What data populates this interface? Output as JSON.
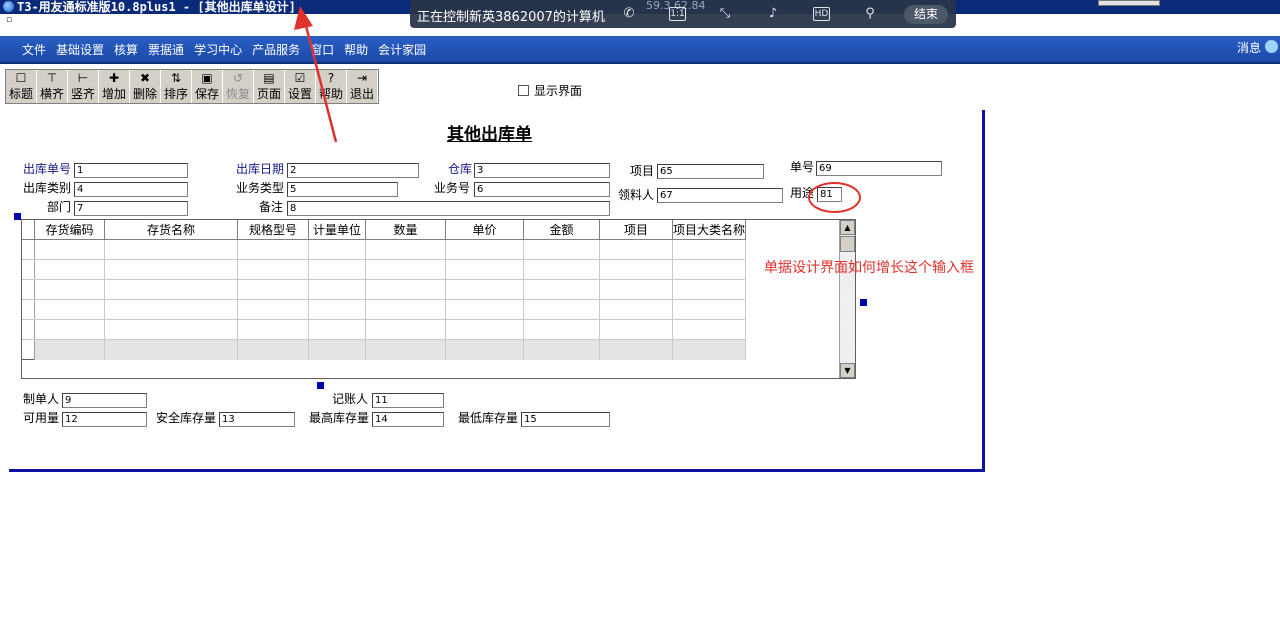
{
  "window": {
    "title": "T3-用友通标准版10.8plus1 - [其他出库单设计]",
    "system_menu_glyph": "▫"
  },
  "remote": {
    "status": "正在控制新英3862007的计算机",
    "ip": "59.3  62.84",
    "icons": [
      "phone-icon",
      "ratio-icon",
      "shrink-icon",
      "volume-icon",
      "hd-icon",
      "pin-icon"
    ],
    "ratio_label": "1:1",
    "hd_label": "HD",
    "end_label": "结束"
  },
  "menu": {
    "items": [
      "文件",
      "基础设置",
      "核算",
      "票据通",
      "学习中心",
      "产品服务",
      "窗口",
      "帮助",
      "会计家园"
    ],
    "message": "消息"
  },
  "toolbar": {
    "buttons": [
      {
        "label": "标题",
        "glyph": "☐"
      },
      {
        "label": "横齐",
        "glyph": "⊤"
      },
      {
        "label": "竖齐",
        "glyph": "⊢"
      },
      {
        "label": "增加",
        "glyph": "✚"
      },
      {
        "label": "删除",
        "glyph": "✖"
      },
      {
        "label": "排序",
        "glyph": "⇅"
      },
      {
        "label": "保存",
        "glyph": "▣"
      },
      {
        "label": "恢复",
        "glyph": "↺"
      },
      {
        "label": "页面",
        "glyph": "▤"
      },
      {
        "label": "设置",
        "glyph": "☑"
      },
      {
        "label": "帮助",
        "glyph": "?"
      },
      {
        "label": "退出",
        "glyph": "⇥"
      }
    ],
    "show_ui_label": "显示界面"
  },
  "form": {
    "title": "其他出库单",
    "fields": {
      "out_no": {
        "label": "出库单号",
        "value": "1"
      },
      "out_date": {
        "label": "出库日期",
        "value": "2"
      },
      "warehouse": {
        "label": "仓库",
        "value": "3"
      },
      "project": {
        "label": "项目",
        "value": "65"
      },
      "doc_no": {
        "label": "单号",
        "value": "69"
      },
      "out_type": {
        "label": "出库类别",
        "value": "4"
      },
      "biz_type": {
        "label": "业务类型",
        "value": "5"
      },
      "biz_no": {
        "label": "业务号",
        "value": "6"
      },
      "receiver": {
        "label": "领料人",
        "value": "67"
      },
      "usage": {
        "label": "用途",
        "value": "81"
      },
      "dept": {
        "label": "部门",
        "value": "7"
      },
      "remark": {
        "label": "备注",
        "value": "8"
      },
      "maker": {
        "label": "制单人",
        "value": "9"
      },
      "bookkeeper": {
        "label": "记账人",
        "value": "11"
      },
      "available": {
        "label": "可用量",
        "value": "12"
      },
      "safe_stock": {
        "label": "安全库存量",
        "value": "13"
      },
      "max_stock": {
        "label": "最高库存量",
        "value": "14"
      },
      "min_stock": {
        "label": "最低库存量",
        "value": "15"
      }
    },
    "grid": {
      "columns": [
        "存货编码",
        "存货名称",
        "规格型号",
        "计量单位",
        "数量",
        "单价",
        "金额",
        "项目",
        "项目大类名称"
      ]
    }
  },
  "annotation": {
    "note": "单据设计界面如何增长这个输入框",
    "color": "#e0312b"
  }
}
